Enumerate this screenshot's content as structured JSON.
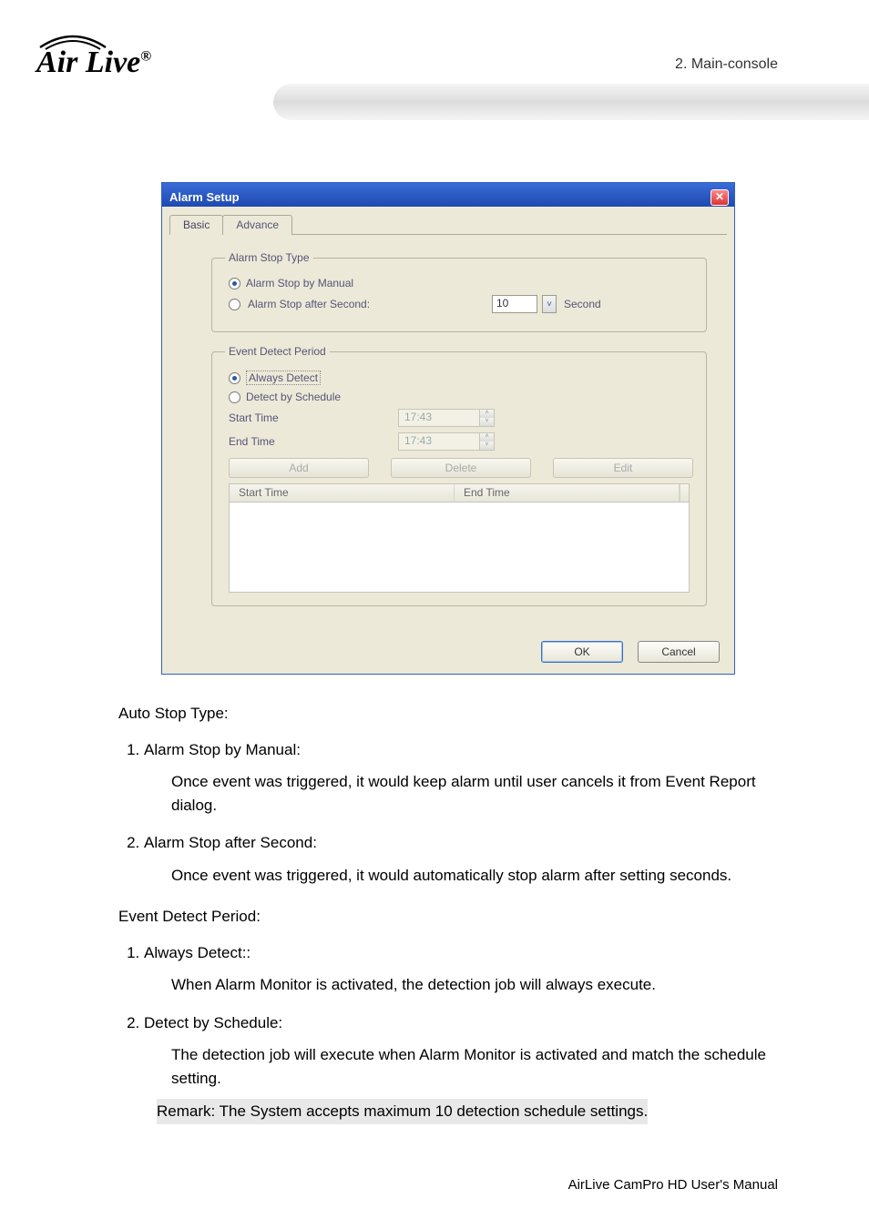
{
  "header": {
    "logo_text": "Air Live",
    "logo_reg": "®",
    "section_ref": "2. Main-console"
  },
  "dialog": {
    "title": "Alarm Setup",
    "close_glyph": "✕",
    "tabs": {
      "basic": "Basic",
      "advance": "Advance"
    },
    "group1": {
      "legend": "Alarm Stop Type",
      "opt_manual": "Alarm Stop by Manual",
      "opt_after_second": "Alarm Stop after Second:",
      "seconds_value": "10",
      "seconds_unit": "Second",
      "chevron": "˅"
    },
    "group2": {
      "legend": "Event Detect Period",
      "opt_always": "Always Detect",
      "opt_schedule": "Detect by Schedule",
      "start_time_label": "Start Time",
      "end_time_label": "End Time",
      "start_time_value": "17:43",
      "end_time_value": "17:43",
      "btn_add": "Add",
      "btn_delete": "Delete",
      "btn_edit": "Edit",
      "col_start": "Start Time",
      "col_end": "End Time",
      "spin_up": "˄",
      "spin_down": "˅"
    },
    "footer": {
      "ok": "OK",
      "cancel": "Cancel"
    }
  },
  "doc": {
    "auto_stop_heading": "Auto Stop Type:",
    "item1_title": "Alarm Stop by Manual:",
    "item1_body": "Once event was triggered, it would keep alarm until user cancels it from Event Report dialog.",
    "item2_title": "Alarm Stop after Second:",
    "item2_body": "Once event was triggered, it would automatically stop alarm after setting seconds.",
    "event_heading": "Event Detect Period:",
    "e1_title": "Always Detect::",
    "e1_body": "When Alarm Monitor is activated, the detection job will always execute.",
    "e2_title": "Detect by Schedule:",
    "e2_body": "The detection job will execute when Alarm Monitor is activated and match the schedule setting.",
    "remark": "Remark: The System accepts maximum 10 detection schedule settings."
  },
  "footer": {
    "manual": "AirLive CamPro HD User's Manual"
  }
}
